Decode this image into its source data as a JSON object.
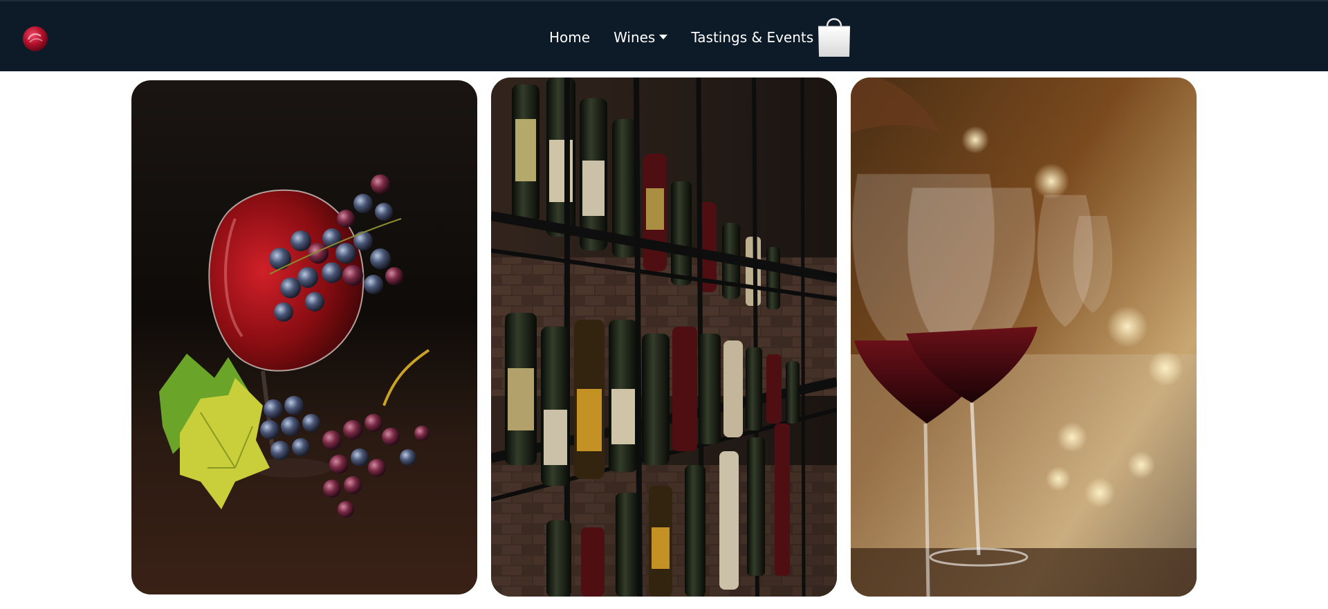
{
  "nav": {
    "links": [
      {
        "label": "Home"
      },
      {
        "label": "Wines",
        "has_dropdown": true
      },
      {
        "label": "Tastings & Events"
      }
    ],
    "logo_icon": "wine-logo-icon",
    "cart_icon": "shopping-bag-icon"
  },
  "gallery": {
    "images": [
      {
        "subject": "red wine glass with grapes and vine leaves"
      },
      {
        "subject": "wine bottles on cellar shelves"
      },
      {
        "subject": "row of wine glasses at a bar"
      }
    ]
  },
  "colors": {
    "navbar_bg": "#0d1a28",
    "nav_text": "#ffffff",
    "accent_wine": "#b0102a"
  }
}
